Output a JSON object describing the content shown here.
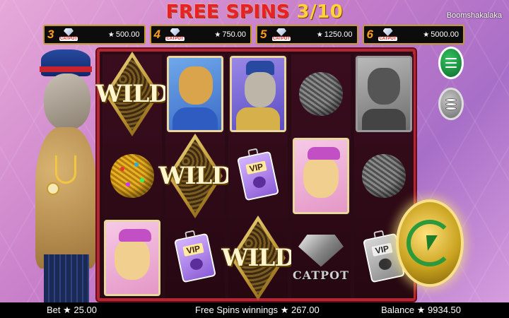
{
  "header": {
    "free_spins_label": "FREE SPINS",
    "free_spins_count": "3/10",
    "game_name": "Boomshakalaka"
  },
  "jackpots": [
    {
      "multiplier": "3",
      "badge": "CATPOT",
      "value": "500.00"
    },
    {
      "multiplier": "4",
      "badge": "CATPOT",
      "value": "750.00"
    },
    {
      "multiplier": "5",
      "badge": "CATPOT",
      "value": "1250.00"
    },
    {
      "multiplier": "6",
      "badge": "CATPOT",
      "value": "5000.00"
    }
  ],
  "reels": {
    "symbols": {
      "wild_label": "WILD",
      "vip_label": "VIP",
      "catpot_label": "CATPOT"
    }
  },
  "footer": {
    "bet_label": "Bet",
    "bet_value": "25.00",
    "winnings_label": "Free Spins winnings",
    "winnings_value": "267.00",
    "balance_label": "Balance",
    "balance_value": "9934.50"
  },
  "colors": {
    "title_red": "#e8202a",
    "title_gold": "#ffd23a",
    "frame_red": "#b42633",
    "menu_green": "#0c6b2c",
    "spin_gold": "#c9a21f"
  },
  "icons": {
    "star": "★"
  }
}
